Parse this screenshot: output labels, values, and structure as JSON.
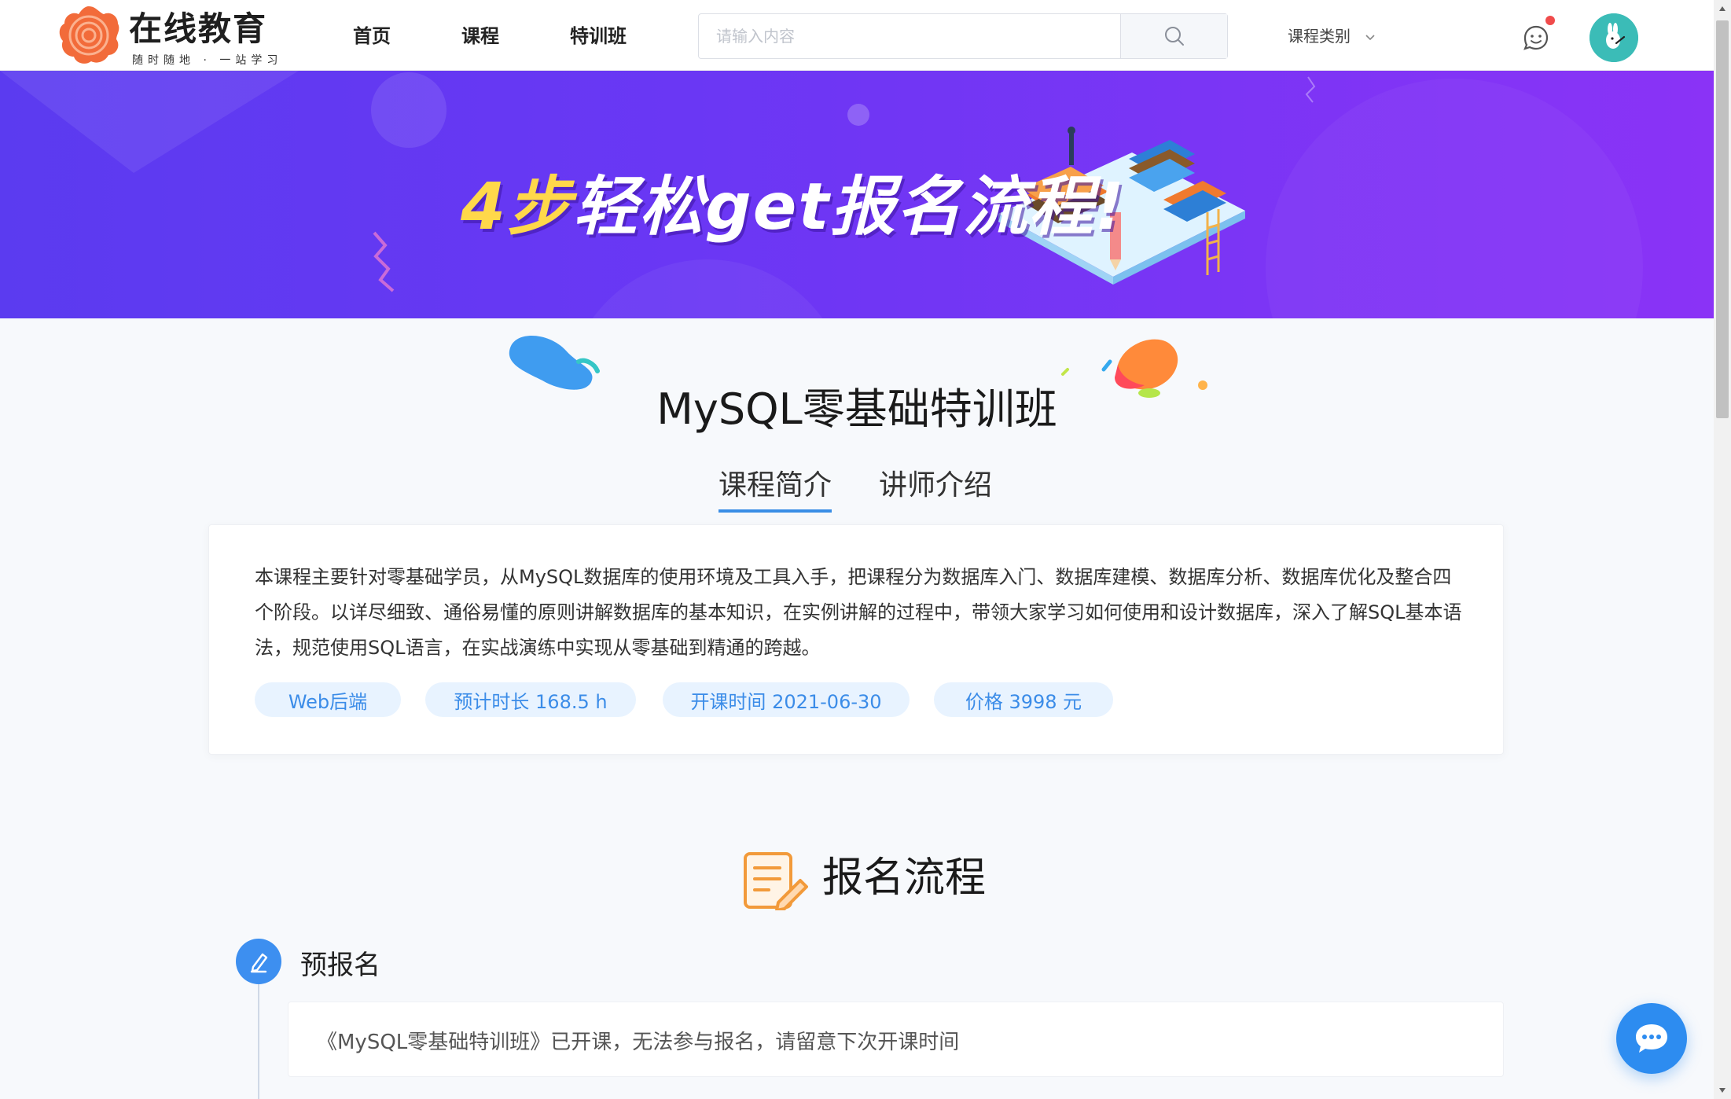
{
  "header": {
    "logo": {
      "title": "在线教育",
      "slogan": "随时随地 · 一站学习"
    },
    "nav": [
      {
        "label": "首页"
      },
      {
        "label": "课程"
      },
      {
        "label": "特训班"
      }
    ],
    "search": {
      "placeholder": "请输入内容",
      "value": ""
    },
    "category_label": "课程类别"
  },
  "banner": {
    "text_highlight": "4步",
    "text_main": "轻松get报名流程!"
  },
  "course": {
    "title": "MySQL零基础特训班",
    "tabs": [
      {
        "label": "课程简介",
        "active": true
      },
      {
        "label": "讲师介绍",
        "active": false
      }
    ],
    "intro": "本课程主要针对零基础学员，从MySQL数据库的使用环境及工具入手，把课程分为数据库入门、数据库建模、数据库分析、数据库优化及整合四个阶段。以详尽细致、通俗易懂的原则讲解数据库的基本知识，在实例讲解的过程中，带领大家学习如何使用和设计数据库，深入了解SQL基本语法，规范使用SQL语言，在实战演练中实现从零基础到精通的跨越。",
    "tags": [
      {
        "label": "Web后端"
      },
      {
        "label": "预计时长 168.5 h"
      },
      {
        "label": "开课时间 2021-06-30"
      },
      {
        "label": "价格 3998 元"
      }
    ]
  },
  "process": {
    "title": "报名流程",
    "steps": [
      {
        "title": "预报名",
        "description": "《MySQL零基础特训班》已开课，无法参与报名，请留意下次开课时间"
      }
    ]
  },
  "colors": {
    "accent": "#3a8ee6",
    "banner_start": "#5b3bf0",
    "banner_end": "#8a33f6",
    "tag_bg": "#e8f3ff",
    "tag_text": "#3b8ce8",
    "chat_fab": "#2d8cf0"
  },
  "icons": {
    "search": "search-icon",
    "chevron": "chevron-down-icon",
    "message": "smile-message-icon",
    "chat": "chat-bubble-icon",
    "process": "document-edit-icon",
    "step": "pen-icon"
  }
}
